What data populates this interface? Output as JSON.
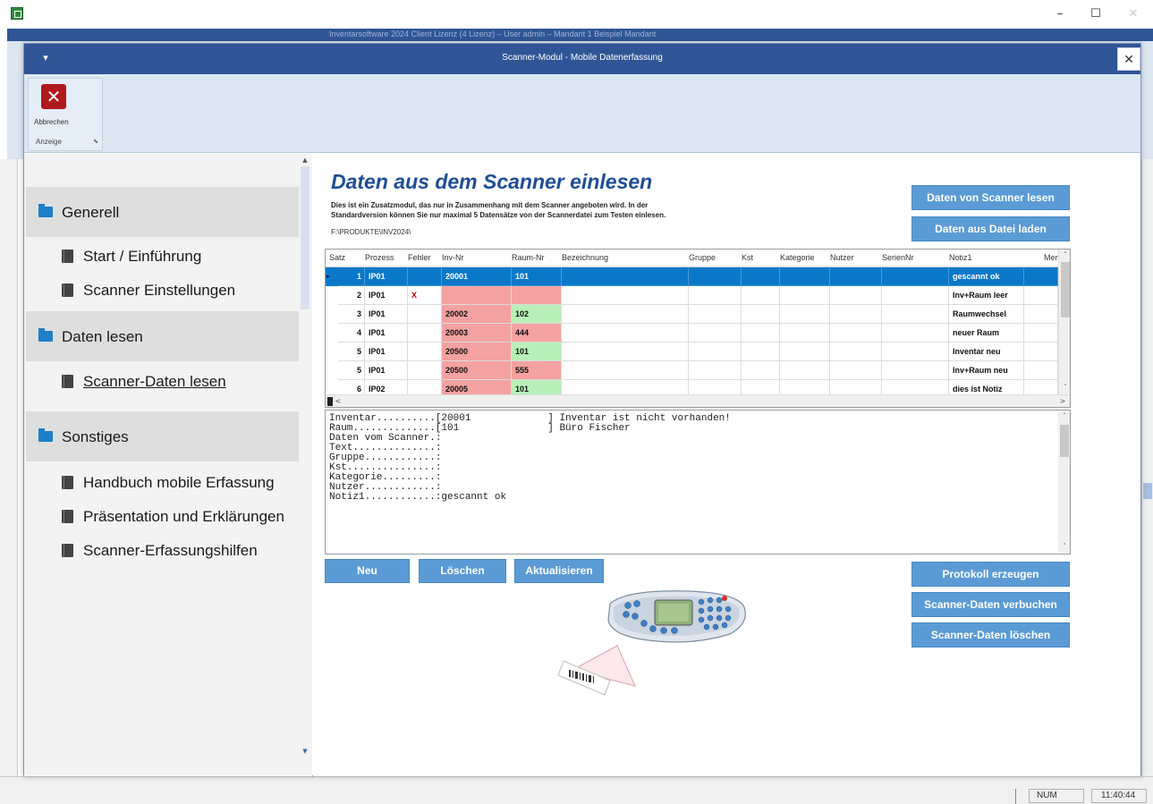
{
  "app": {
    "title_blurred": "Inventarsoftware 2024 Client Lizenz (4 Lizenz) – User admin – Mandant 1 Beispiel Mandant",
    "status": {
      "num": "NUM",
      "time": "11:40:44"
    },
    "window_controls": {
      "minimize": "–",
      "maximize": "☐",
      "close": "✕"
    }
  },
  "dialog": {
    "title": "Scanner-Modul - Mobile Datenerfassung",
    "menu_icon": "▾",
    "close": "✕"
  },
  "ribbon": {
    "cancel_label": "Abbrechen",
    "cancel_icon": "✕",
    "group_label": "Anzeige",
    "launcher": "⬊"
  },
  "nav": {
    "sections": [
      {
        "label": "Generell",
        "items": [
          "Start / Einführung",
          "Scanner Einstellungen"
        ]
      },
      {
        "label": "Daten lesen",
        "items": [
          "Scanner-Daten lesen"
        ]
      },
      {
        "label": "Sonstiges",
        "items": [
          "Handbuch mobile Erfassung",
          "Präsentation und Erklärungen",
          "Scanner-Erfassungshilfen"
        ]
      }
    ],
    "scroll_up": "▲",
    "scroll_down": "▼"
  },
  "main": {
    "title": "Daten aus dem Scanner einlesen",
    "description_line1": "Dies ist ein Zusatzmodul, das nur in Zusammenhang mit dem Scanner angeboten wird. In der",
    "description_line2": "Standardversion können Sie nur maximal 5 Datensätze von der Scannerdatei zum Testen einlesen.",
    "path": "F:\\PRODUKTE\\INV2024\\",
    "buttons": {
      "read_scanner": "Daten von Scanner lesen",
      "load_file": "Daten aus Datei laden",
      "neu": "Neu",
      "loeschen": "Löschen",
      "aktualisieren": "Aktualisieren",
      "protokoll": "Protokoll erzeugen",
      "verbuchen": "Scanner-Daten verbuchen",
      "scan_loeschen": "Scanner-Daten löschen"
    }
  },
  "grid": {
    "columns": [
      "Satz",
      "Prozess",
      "Fehler",
      "Inv-Nr",
      "Raum-Nr",
      "Bezeichnung",
      "Gruppe",
      "Kst",
      "Kategorie",
      "Nutzer",
      "SerienNr",
      "Notiz1",
      "Men"
    ],
    "rows": [
      {
        "satz": "1",
        "prozess": "IP01",
        "fehler": "",
        "inv": "20001",
        "raum": "101",
        "notiz": "gescannt ok"
      },
      {
        "satz": "2",
        "prozess": "IP01",
        "fehler": "X",
        "inv": "",
        "raum": "",
        "notiz": "Inv+Raum leer"
      },
      {
        "satz": "3",
        "prozess": "IP01",
        "fehler": "",
        "inv": "20002",
        "raum": "102",
        "notiz": "Raumwechsel"
      },
      {
        "satz": "4",
        "prozess": "IP01",
        "fehler": "",
        "inv": "20003",
        "raum": "444",
        "notiz": "neuer Raum"
      },
      {
        "satz": "5",
        "prozess": "IP01",
        "fehler": "",
        "inv": "20500",
        "raum": "101",
        "notiz": "Inventar neu"
      },
      {
        "satz": "5",
        "prozess": "IP01",
        "fehler": "",
        "inv": "20500",
        "raum": "555",
        "notiz": "Inv+Raum neu"
      },
      {
        "satz": "6",
        "prozess": "IP02",
        "fehler": "",
        "inv": "20005",
        "raum": "101",
        "notiz": "dies ist Notiz"
      }
    ],
    "scroll_up": "˄",
    "scroll_down": "˅",
    "scroll_left": "<",
    "scroll_right": ">"
  },
  "detail": {
    "lines": [
      "Inventar..........[20001             ] Inventar ist nicht vorhanden!",
      "Raum..............[101               ] Büro Fischer",
      "Daten vom Scanner.:",
      "Text..............:",
      "Gruppe............:",
      "Kst...............:",
      "Kategorie.........:",
      "Nutzer............:",
      "Notiz1............:gescannt ok"
    ]
  }
}
